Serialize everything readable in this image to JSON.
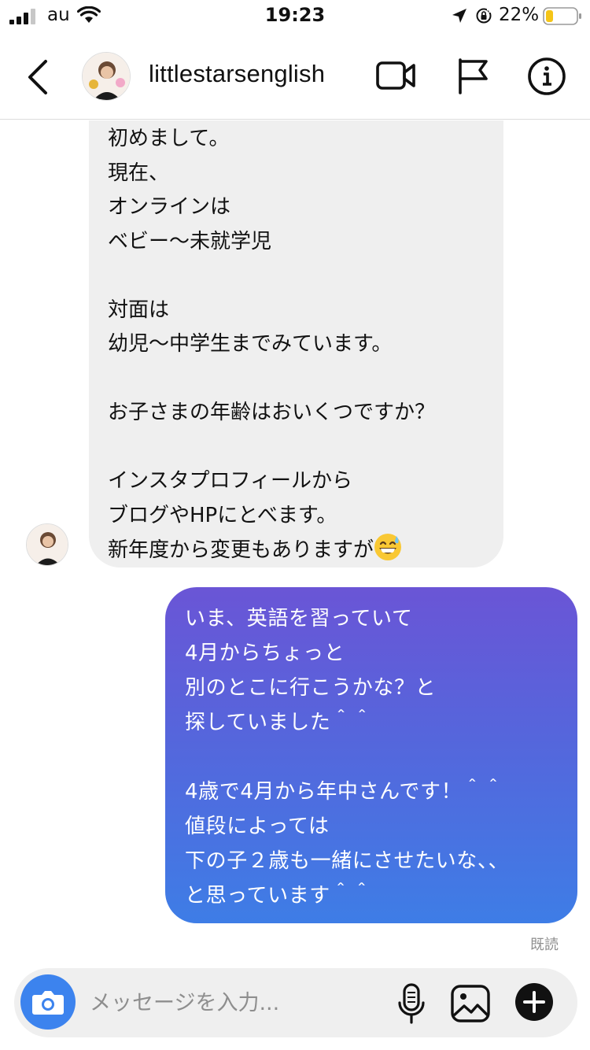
{
  "status": {
    "carrier": "au",
    "time": "19:23",
    "battery": "22%",
    "battery_level": 0.22,
    "colors": {
      "battery_fill": "#f5c518"
    }
  },
  "header": {
    "username": "littlestarsenglish",
    "icons": [
      "chevron-left-icon",
      "video-camera-icon",
      "flag-icon",
      "info-icon"
    ]
  },
  "messages": {
    "received_text": "初めまして。\n現在、\nオンラインは\nベビー〜未就学児\n\n対面は\n幼児〜中学生までみています。\n\nお子さまの年齢はおいくつですか？\n\nインスタプロフィールから\nブログやHPにとべます。\n新年度から変更もありますが",
    "received_emoji": "grinning-sweat-emoji",
    "sent_text": "いま、英語を習っていて\n4月からちょっと\n別のとこに行こうかな？と\n探していました＾＾\n\n4歳で4月から年中さんです！＾＾\n値段によっては\n下の子２歳も一緒にさせたいな、、\nと思っています＾＾",
    "read_receipt": "既読",
    "colors": {
      "sent_top": "#6a55d6",
      "sent_bottom": "#3e7de6",
      "received_bg": "#efefef"
    }
  },
  "composer": {
    "placeholder": "メッセージを入力...",
    "icons": [
      "camera-icon",
      "microphone-icon",
      "gallery-icon",
      "plus-icon"
    ],
    "colors": {
      "camera_button": "#3c83ee"
    }
  }
}
